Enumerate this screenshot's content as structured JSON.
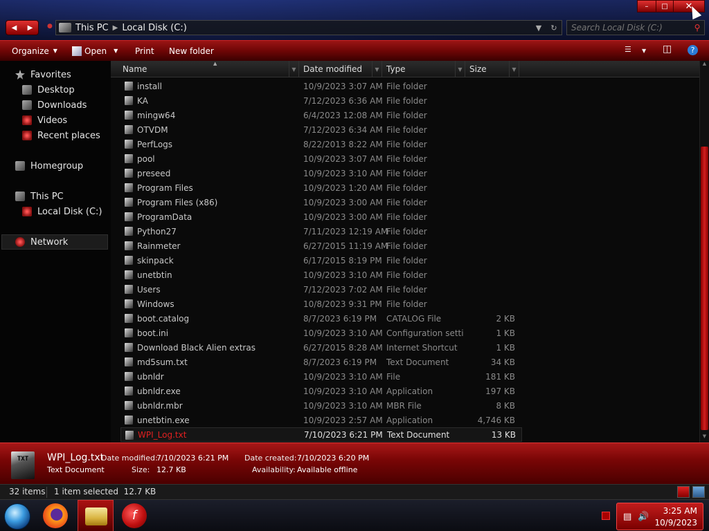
{
  "window": {
    "breadcrumb": [
      "This PC",
      "Local Disk (C:)"
    ],
    "search_placeholder": "Search Local Disk (C:)"
  },
  "toolbar": {
    "organize": "Organize",
    "open": "Open",
    "print": "Print",
    "new_folder": "New folder"
  },
  "nav": {
    "favorites": "Favorites",
    "desktop": "Desktop",
    "downloads": "Downloads",
    "videos": "Videos",
    "recent_places": "Recent places",
    "homegroup": "Homegroup",
    "this_pc": "This PC",
    "local_disk": "Local Disk (C:)",
    "network": "Network"
  },
  "columns": {
    "name": "Name",
    "date_modified": "Date modified",
    "type": "Type",
    "size": "Size"
  },
  "files": [
    {
      "name": "install",
      "date": "10/9/2023 3:07 AM",
      "type": "File folder",
      "size": ""
    },
    {
      "name": "KA",
      "date": "7/12/2023 6:36 AM",
      "type": "File folder",
      "size": ""
    },
    {
      "name": "mingw64",
      "date": "6/4/2023 12:08 AM",
      "type": "File folder",
      "size": ""
    },
    {
      "name": "OTVDM",
      "date": "7/12/2023 6:34 AM",
      "type": "File folder",
      "size": ""
    },
    {
      "name": "PerfLogs",
      "date": "8/22/2013 8:22 AM",
      "type": "File folder",
      "size": ""
    },
    {
      "name": "pool",
      "date": "10/9/2023 3:07 AM",
      "type": "File folder",
      "size": ""
    },
    {
      "name": "preseed",
      "date": "10/9/2023 3:10 AM",
      "type": "File folder",
      "size": ""
    },
    {
      "name": "Program Files",
      "date": "10/9/2023 1:20 AM",
      "type": "File folder",
      "size": ""
    },
    {
      "name": "Program Files (x86)",
      "date": "10/9/2023 3:00 AM",
      "type": "File folder",
      "size": ""
    },
    {
      "name": "ProgramData",
      "date": "10/9/2023 3:00 AM",
      "type": "File folder",
      "size": ""
    },
    {
      "name": "Python27",
      "date": "7/11/2023 12:19 AM",
      "type": "File folder",
      "size": ""
    },
    {
      "name": "Rainmeter",
      "date": "6/27/2015 11:19 AM",
      "type": "File folder",
      "size": ""
    },
    {
      "name": "skinpack",
      "date": "6/17/2015 8:19 PM",
      "type": "File folder",
      "size": ""
    },
    {
      "name": "unetbtin",
      "date": "10/9/2023 3:10 AM",
      "type": "File folder",
      "size": ""
    },
    {
      "name": "Users",
      "date": "7/12/2023 7:02 AM",
      "type": "File folder",
      "size": ""
    },
    {
      "name": "Windows",
      "date": "10/8/2023 9:31 PM",
      "type": "File folder",
      "size": ""
    },
    {
      "name": "boot.catalog",
      "date": "8/7/2023 6:19 PM",
      "type": "CATALOG File",
      "size": "2 KB"
    },
    {
      "name": "boot.ini",
      "date": "10/9/2023 3:10 AM",
      "type": "Configuration settin...",
      "size": "1 KB"
    },
    {
      "name": "Download Black Alien extras",
      "date": "6/27/2015 8:28 AM",
      "type": "Internet Shortcut",
      "size": "1 KB"
    },
    {
      "name": "md5sum.txt",
      "date": "8/7/2023 6:19 PM",
      "type": "Text Document",
      "size": "34 KB"
    },
    {
      "name": "ubnldr",
      "date": "10/9/2023 3:10 AM",
      "type": "File",
      "size": "181 KB"
    },
    {
      "name": "ubnldr.exe",
      "date": "10/9/2023 3:10 AM",
      "type": "Application",
      "size": "197 KB"
    },
    {
      "name": "ubnldr.mbr",
      "date": "10/9/2023 3:10 AM",
      "type": "MBR File",
      "size": "8 KB"
    },
    {
      "name": "unetbtin.exe",
      "date": "10/9/2023 2:57 AM",
      "type": "Application",
      "size": "4,746 KB"
    },
    {
      "name": "WPI_Log.txt",
      "date": "7/10/2023 6:21 PM",
      "type": "Text Document",
      "size": "13 KB"
    }
  ],
  "details": {
    "icon_text": "TXT",
    "filename": "WPI_Log.txt",
    "file_type": "Text Document",
    "date_modified_label": "Date modified:",
    "date_modified": "7/10/2023 6:21 PM",
    "size_label": "Size:",
    "size": "12.7 KB",
    "date_created_label": "Date created:",
    "date_created": "7/10/2023 6:20 PM",
    "availability_label": "Availability:",
    "availability": "Available offline"
  },
  "status": {
    "item_count": "32 items",
    "selection": "1 item selected  12.7 KB"
  },
  "clock": {
    "time": "3:25 AM",
    "date": "10/9/2023"
  },
  "colors": {
    "accent_red": "#b01515",
    "selected_text": "#e02020"
  }
}
